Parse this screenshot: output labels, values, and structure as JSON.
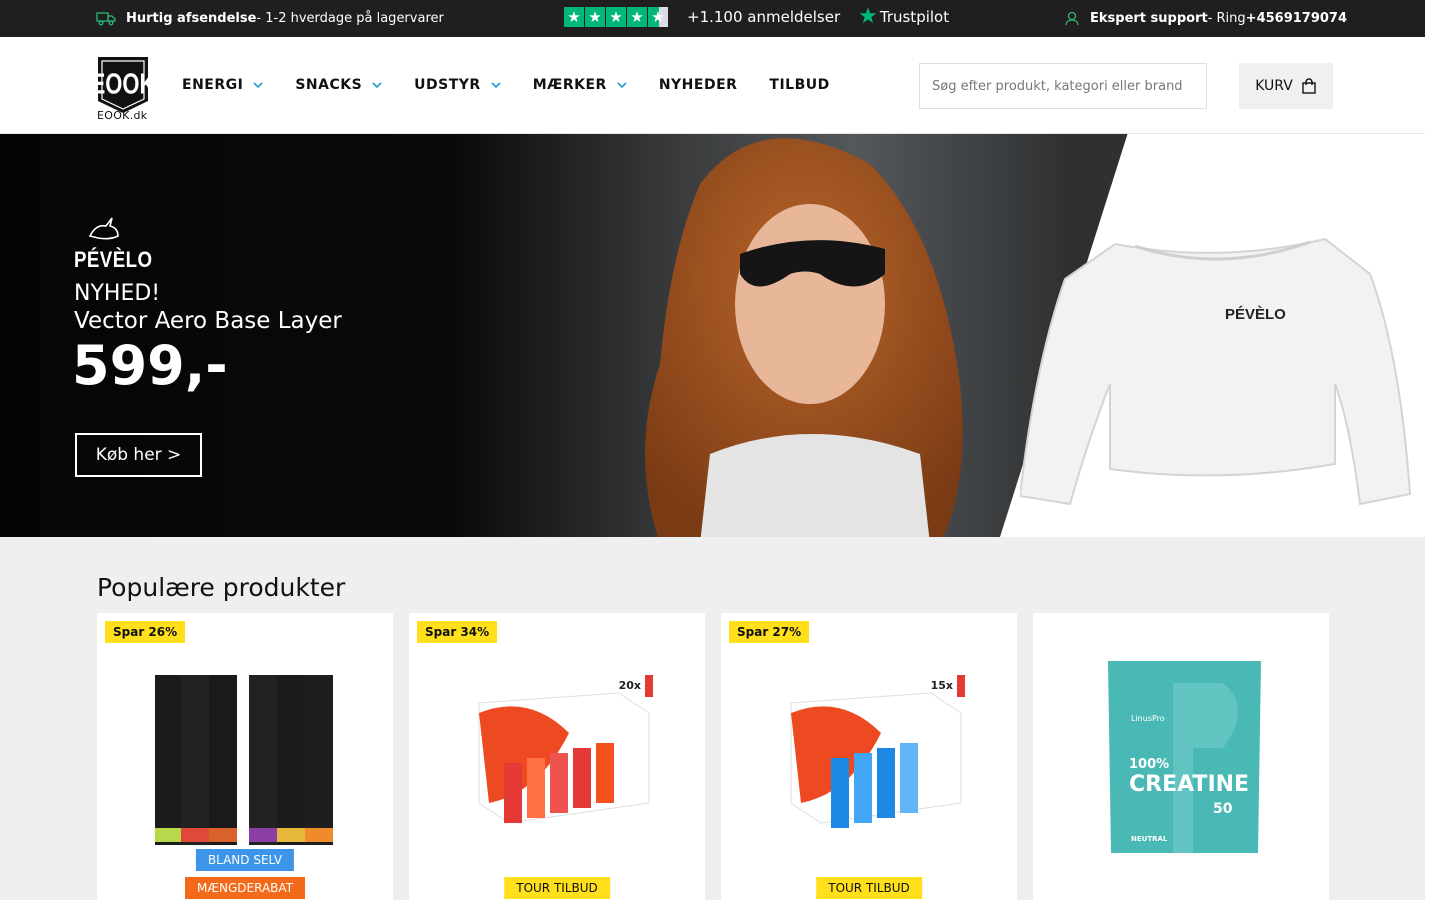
{
  "topbar": {
    "shipping_bold": "Hurtig afsendelse",
    "shipping_rest": "- 1-2 hverdage på lagervarer",
    "reviews_count": "+1.100 anmeldelser",
    "trustpilot": "Trustpilot",
    "support_bold": "Ekspert support",
    "support_rest": "- Ring",
    "support_phone": "+4569179074"
  },
  "header": {
    "logo_text": "EOOK.dk",
    "nav": [
      {
        "label": "ENERGI",
        "has_dropdown": true
      },
      {
        "label": "SNACKS",
        "has_dropdown": true
      },
      {
        "label": "UDSTYR",
        "has_dropdown": true
      },
      {
        "label": "MÆRKER",
        "has_dropdown": true
      },
      {
        "label": "NYHEDER",
        "has_dropdown": false
      },
      {
        "label": "TILBUD",
        "has_dropdown": false
      }
    ],
    "search_placeholder": "Søg efter produkt, kategori eller brand",
    "cart_label": "KURV"
  },
  "hero": {
    "brand": "PÉVÈLO",
    "kicker": "NYHED!",
    "title": "Vector Aero Base Layer",
    "price": "599,-",
    "cta": "Køb her >",
    "shirt_brand": "PÉVÈLO"
  },
  "products": {
    "title": "Populære produkter",
    "items": [
      {
        "save": "Spar 26%",
        "tags": [
          "BLAND SELV",
          "MÆNGDERABAT"
        ],
        "image": "hydro-tubes"
      },
      {
        "save": "Spar 34%",
        "tags": [
          "TOUR TILBUD"
        ],
        "image": "high5-gel-20x",
        "count": "20x"
      },
      {
        "save": "Spar 27%",
        "tags": [
          "TOUR TILBUD"
        ],
        "image": "high5-gel-15x",
        "count": "15x"
      },
      {
        "save": "",
        "tags": [],
        "image": "creatine-bag",
        "brand": "LinusPro",
        "pct": "100%",
        "name": "CREATINE",
        "servings": "50",
        "flavor": "NEUTRAL"
      }
    ]
  },
  "colors": {
    "topbar_bg": "#1f1f1f",
    "trustpilot_green": "#00b67a",
    "save_yellow": "#ffe01b",
    "tag_blue": "#3d95ea",
    "tag_orange": "#f26a1a",
    "section_bg": "#efefef"
  }
}
